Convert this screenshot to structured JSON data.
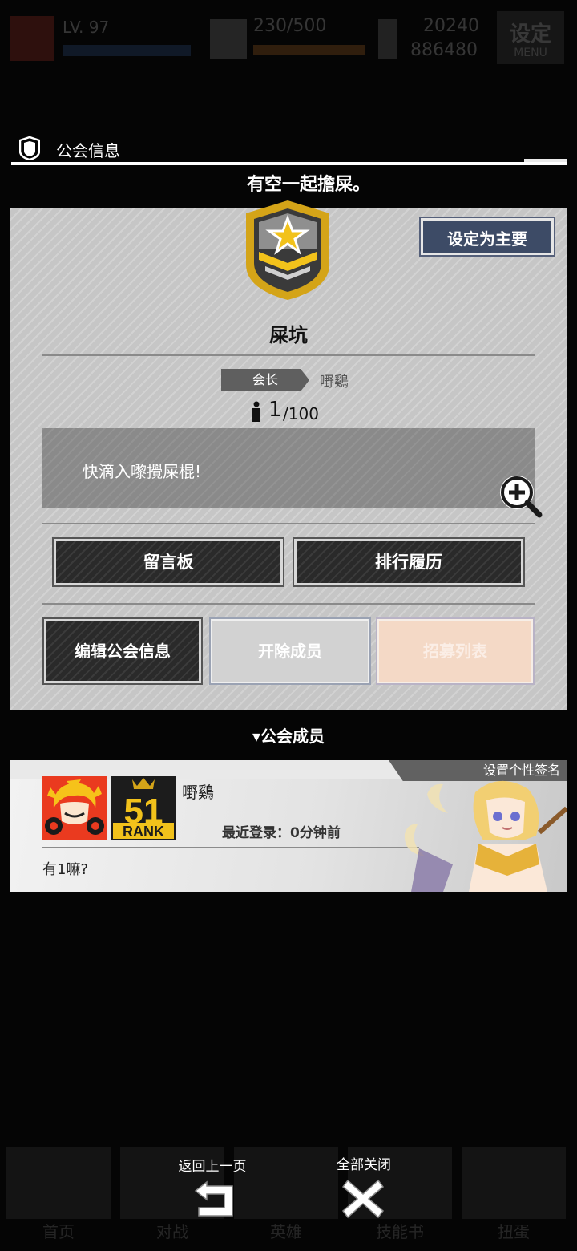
{
  "hud": {
    "level": "LV.",
    "level_sub": "97",
    "stamina": "230/500",
    "currency_1": "20240",
    "currency_2": "886480",
    "menu_label": "设定",
    "menu_sub": "MENU"
  },
  "panel": {
    "title": "公会信息",
    "motto": "有空一起擔屎。"
  },
  "guild": {
    "set_main_label": "设定为主要",
    "name": "屎坑",
    "leader_tag": "会长",
    "leader_name": "嘢鷄",
    "member_count": "1",
    "member_max": "/100",
    "notice": "快滴入嚟攪屎棍!"
  },
  "buttons": {
    "message_board": "留言板",
    "ranking_history": "排行履历",
    "edit_info": "编辑公会信息",
    "kick_member": "开除成员",
    "recruit_list": "招募列表"
  },
  "members_section": {
    "title": "▾公会成员"
  },
  "member": {
    "signature_tag": "设置个性签名",
    "name": "嘢鷄",
    "rank_text": "51",
    "rank_label": "RANK",
    "last_login": "最近登录：0分钟前",
    "signature": "有1嘛?"
  },
  "bottom_nav": [
    "首页",
    "对战",
    "英雄",
    "技能书",
    "扭蛋"
  ],
  "controls": {
    "back_label": "返回上一页",
    "close_all_label": "全部关闭"
  },
  "colors": {
    "card_gray": "#c6c6c6",
    "dark_button": "#2a2a2a",
    "set_main_button": "#3d4b66",
    "emblem_gold": "#d4a418",
    "recruit_button": "#f4d9c6"
  }
}
